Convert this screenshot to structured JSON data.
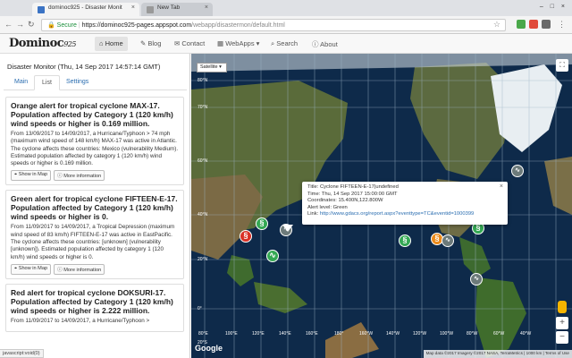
{
  "browser": {
    "tabs": [
      {
        "title": "dominoc925 - Disaster Monit"
      },
      {
        "title": "New Tab"
      }
    ],
    "secure_label": "Secure",
    "url_host": "https://dominoc925-pages.appspot.com",
    "url_path": "/webapp/disastermon/default.html"
  },
  "site": {
    "logo": "Dominoc",
    "logo_sup": "925",
    "nav": [
      {
        "label": "Home",
        "icon": "home-icon"
      },
      {
        "label": "Blog",
        "icon": "pencil-icon"
      },
      {
        "label": "Contact",
        "icon": "envelope-icon"
      },
      {
        "label": "WebApps",
        "icon": "grid-icon"
      },
      {
        "label": "Search",
        "icon": "search-icon"
      },
      {
        "label": "About",
        "icon": "info-icon"
      }
    ]
  },
  "panel": {
    "title": "Disaster Monitor (Thu, 14 Sep 2017 14:57:14 GMT)",
    "tabs": [
      "Main",
      "List",
      "Settings"
    ],
    "show_in_map": "Show in Map",
    "more_info": "More information",
    "alerts": [
      {
        "heading": "Orange alert for tropical cyclone MAX-17. Population affected by Category 1 (120 km/h) wind speeds or higher is 0.169 million.",
        "body": "From 13/09/2017 to 14/09/2017, a Hurricane/Typhoon > 74 mph (maximum wind speed of 148 km/h) MAX-17 was active in Atlantic. The cyclone affects these countries: Mexico (vulnerability Medium). Estimated population affected by category 1 (120 km/h) wind speeds or higher is 0.169 million."
      },
      {
        "heading": "Green alert for tropical cyclone FIFTEEN-E-17. Population affected by Category 1 (120 km/h) wind speeds or higher is 0.",
        "body": "From 11/09/2017 to 14/09/2017, a Tropical Depression (maximum wind speed of 83 km/h) FIFTEEN-E-17 was active in EastPacific. The cyclone affects these countries: [unknown] (vulnerability [unknown]). Estimated population affected by category 1 (120 km/h) wind speeds or higher is 0."
      },
      {
        "heading": "Red alert for tropical cyclone DOKSURI-17. Population affected by Category 1 (120 km/h) wind speeds or higher is 2.222 million.",
        "body": "From 11/09/2017 to 14/09/2017, a Hurricane/Typhoon >"
      }
    ],
    "status": "javascript:void(0)"
  },
  "map": {
    "type_select": "Satellite",
    "lat_labels": [
      "80°N",
      "70°N",
      "60°N",
      "40°N",
      "20°N",
      "0°",
      "20°S"
    ],
    "lon_labels": [
      "80°E",
      "100°E",
      "120°E",
      "140°E",
      "160°E",
      "180°",
      "160°W",
      "140°W",
      "120°W",
      "100°W",
      "80°W",
      "60°W",
      "40°W"
    ],
    "google": "Google",
    "attribution": "Map data ©2017 Imagery ©2017 NASA, TerraMetrics  |  1000 km  |  Terms of Use",
    "infowindow": {
      "title": "Title: Cyclone FIFTEEN-E-17|undefined",
      "time": "Time: Thu, 14 Sep 2017 15:00:00 GMT",
      "coords": "Coordinates: 15.400N,122.800W",
      "level": "Alert level: Green",
      "link_label": "Link:",
      "link": "http://www.gdacs.org/report.aspx?eventtype=TC&eventid=1000399"
    }
  }
}
